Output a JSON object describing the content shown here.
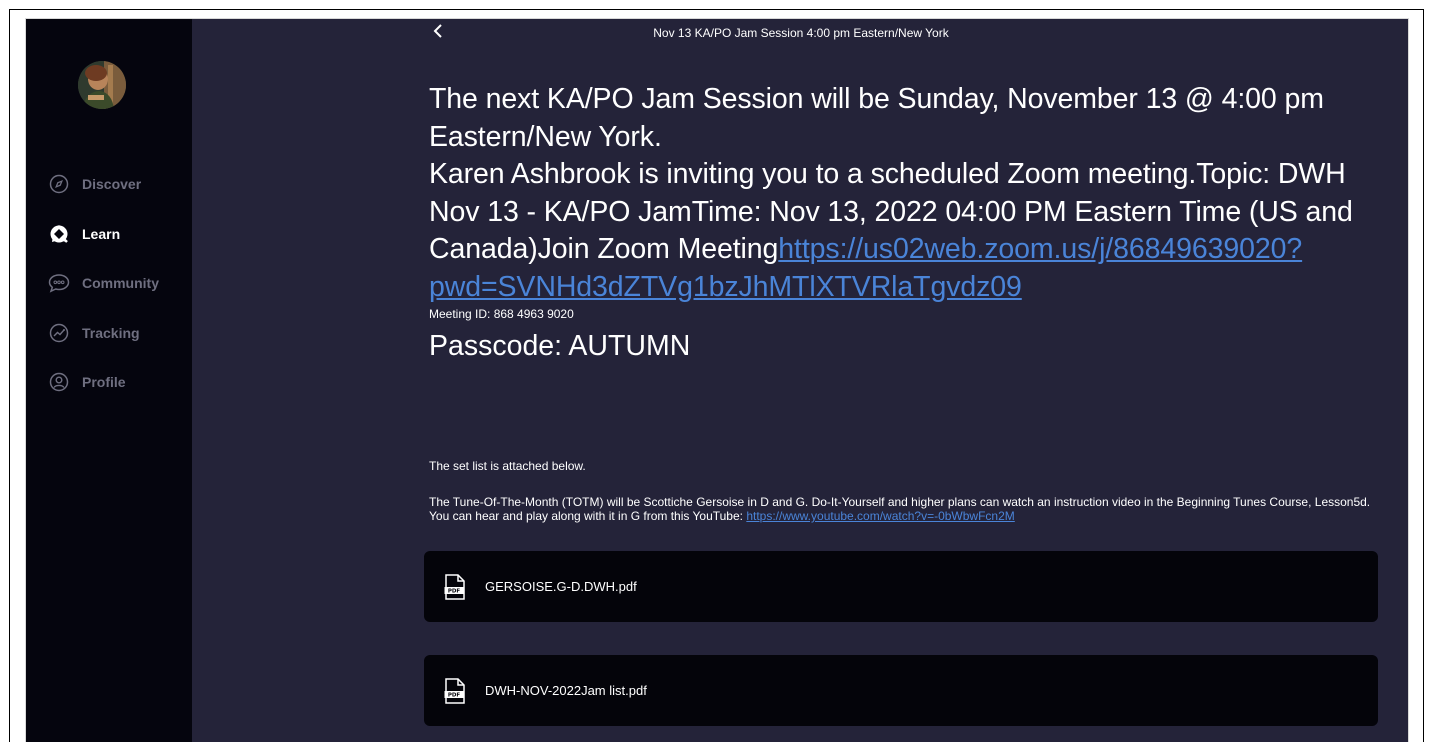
{
  "header": {
    "title": "Nov 13 KA/PO Jam Session 4:00 pm Eastern/New York"
  },
  "sidebar": {
    "items": [
      {
        "label": "Discover",
        "icon": "compass-icon",
        "active": false
      },
      {
        "label": "Learn",
        "icon": "learn-icon",
        "active": true
      },
      {
        "label": "Community",
        "icon": "chat-bubble-icon",
        "active": false
      },
      {
        "label": "Tracking",
        "icon": "tracking-icon",
        "active": false
      },
      {
        "label": "Profile",
        "icon": "person-icon",
        "active": false
      }
    ]
  },
  "post": {
    "intro": "The next KA/PO Jam Session will be Sunday, November 13 @ 4:00 pm Eastern/New York.",
    "invite": "Karen Ashbrook is inviting you to a scheduled Zoom meeting.Topic: DWH Nov 13 - KA/PO JamTime: Nov 13, 2022 04:00 PM Eastern Time (US and Canada)Join Zoom Meeting",
    "zoom_link": "https://us02web.zoom.us/j/86849639020?pwd=SVNHd3dZTVg1bzJhMTlXTVRlaTgvdz09",
    "meeting_id": "Meeting ID: 868 4963 9020",
    "passcode": "Passcode: AUTUMN",
    "setlist_note": "The set list is attached below.",
    "totm_text": "The Tune-Of-The-Month (TOTM) will be Scottiche Gersoise in D and G. Do-It-Yourself and higher plans can watch an instruction video in the Beginning Tunes Course, Lesson5d. You can hear and play along with it in G from this YouTube: ",
    "youtube_link": "https://www.youtube.com/watch?v=-0bWbwFcn2M"
  },
  "attachments": [
    {
      "name": "GERSOISE.G-D.DWH.pdf",
      "icon": "pdf-file-icon"
    },
    {
      "name": "DWH-NOV-2022Jam list.pdf",
      "icon": "pdf-file-icon"
    }
  ],
  "colors": {
    "background": "#242339",
    "sidebar": "#05050e",
    "link": "#4a84d8",
    "attachment_card": "#04040a",
    "nav_inactive": "#6f6f80"
  }
}
